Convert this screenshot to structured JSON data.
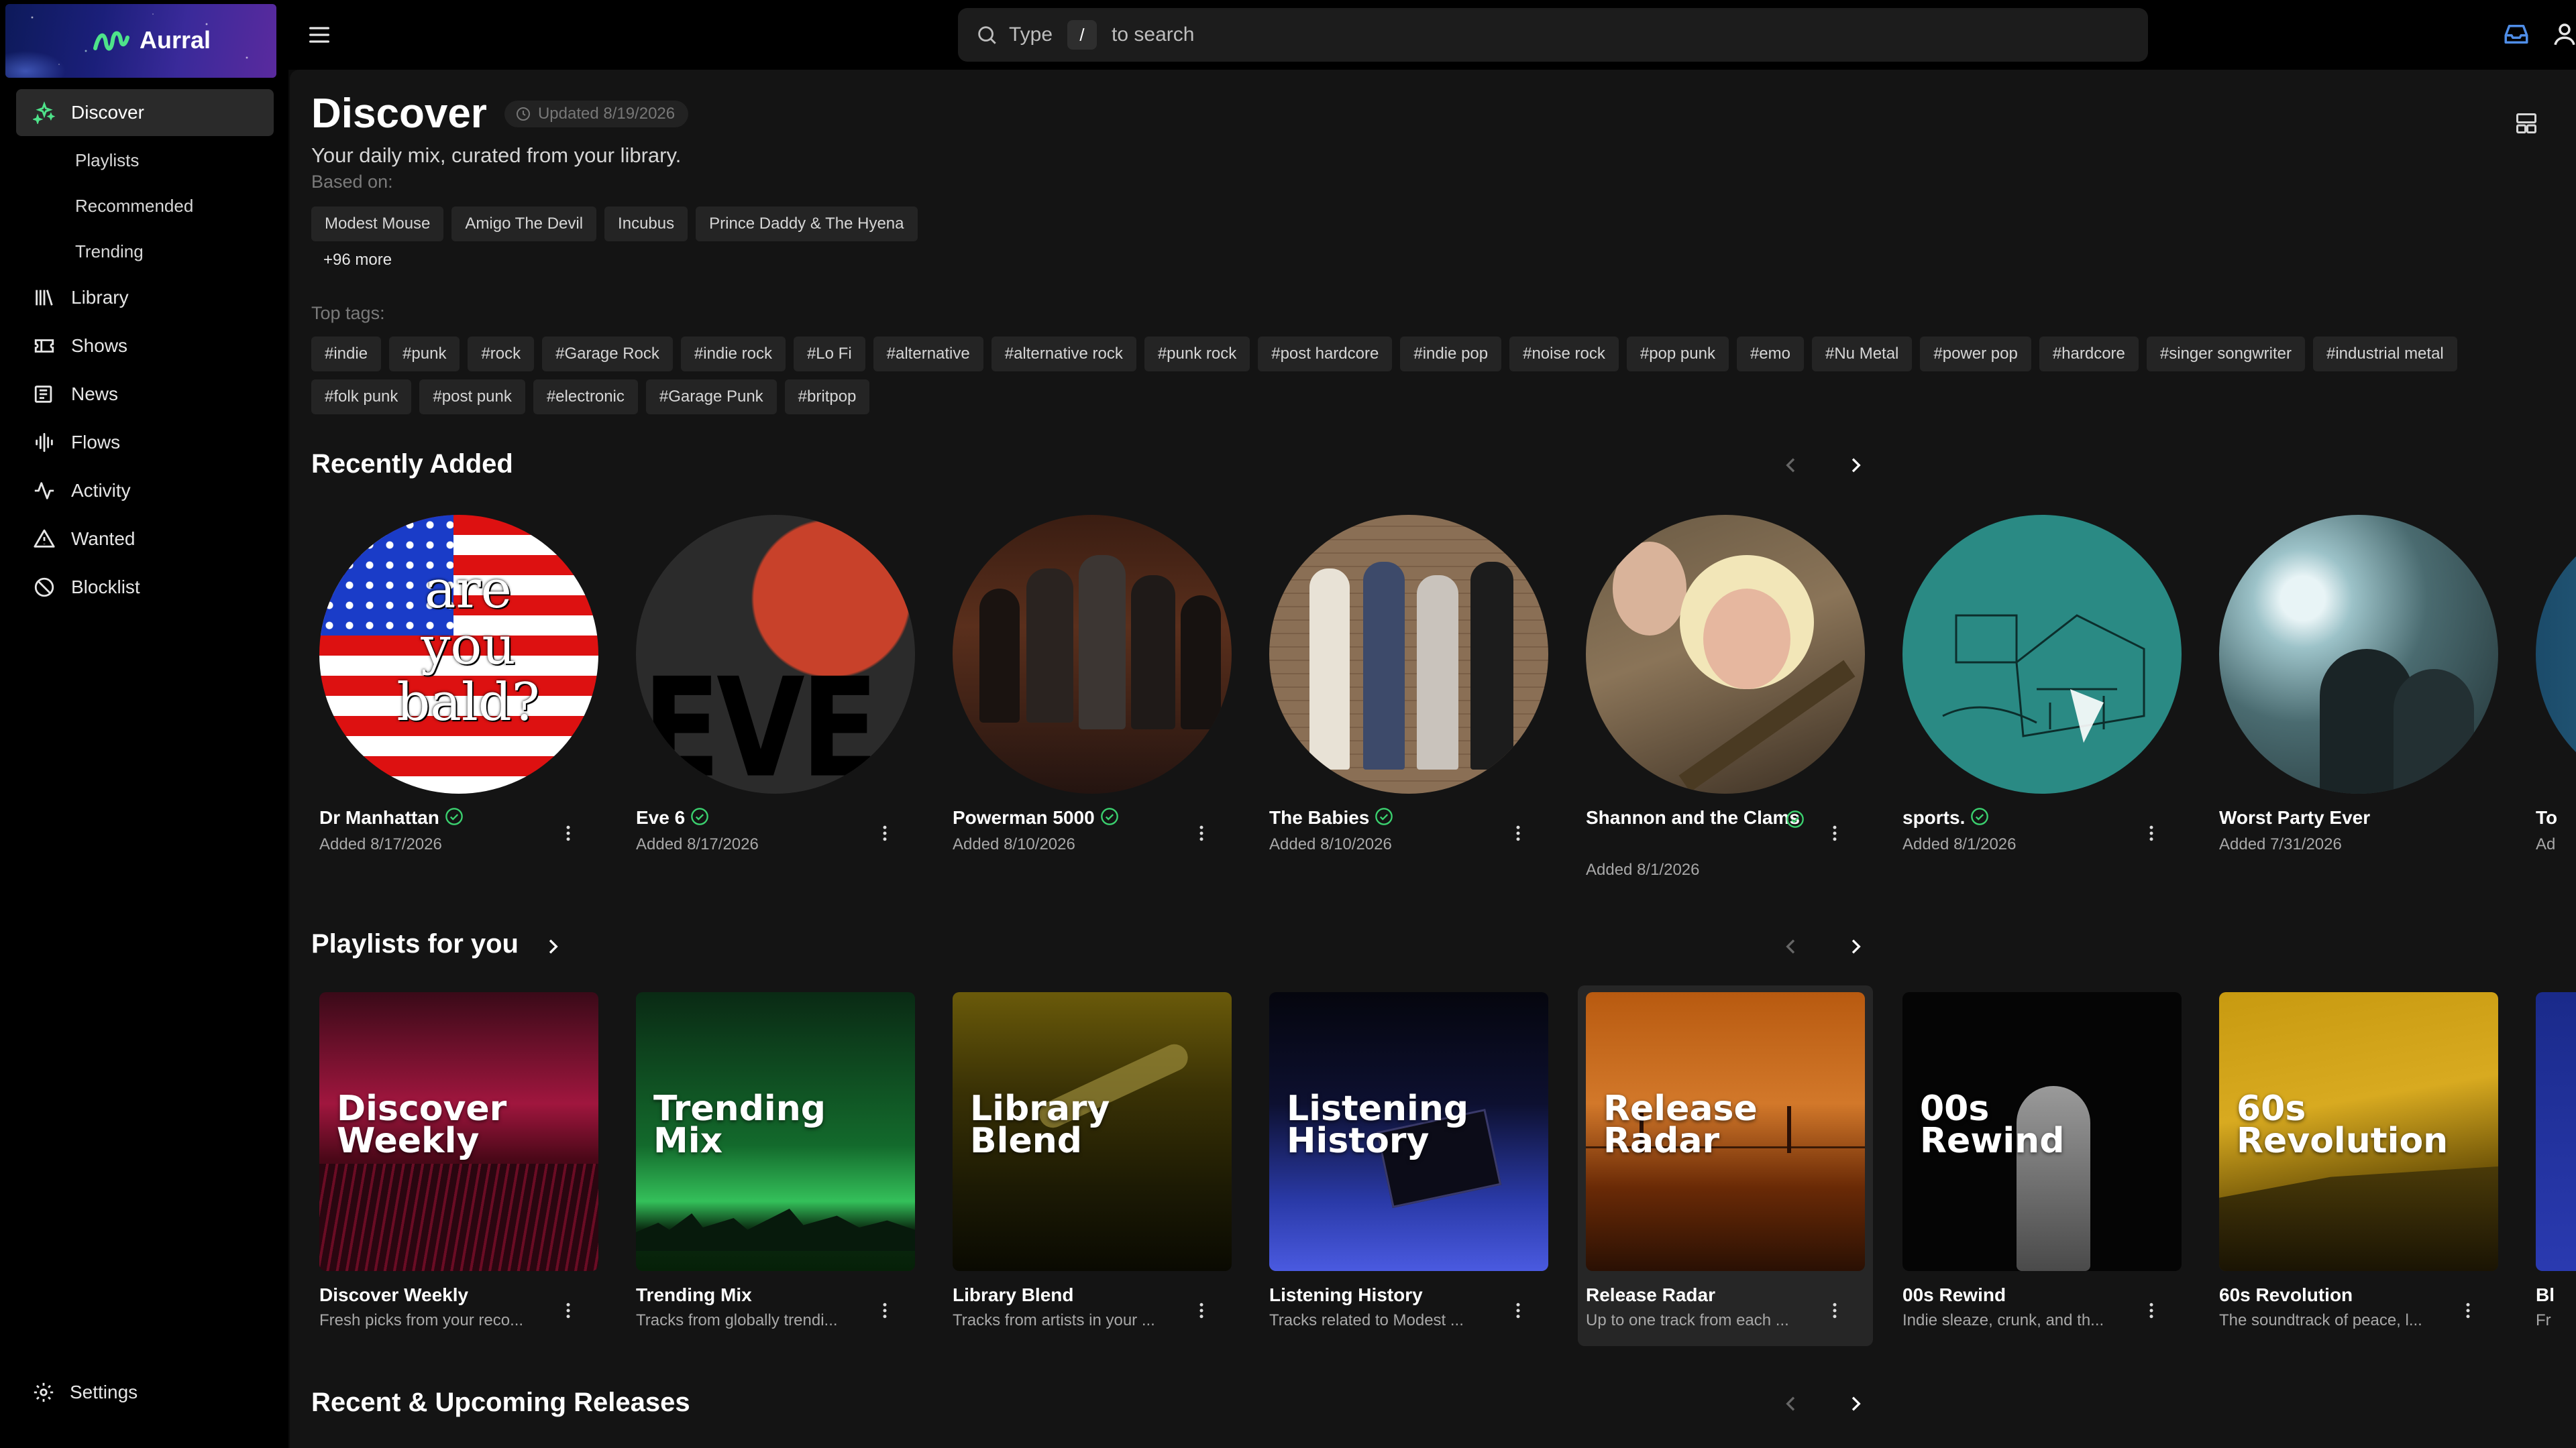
{
  "app": {
    "name": "Aurral"
  },
  "sidebar": {
    "items": [
      {
        "label": "Discover",
        "icon": "sparkles-icon",
        "active": true
      },
      {
        "label": "Playlists",
        "sub": true
      },
      {
        "label": "Recommended",
        "sub": true
      },
      {
        "label": "Trending",
        "sub": true
      },
      {
        "label": "Library",
        "icon": "library-icon"
      },
      {
        "label": "Shows",
        "icon": "ticket-icon"
      },
      {
        "label": "News",
        "icon": "newspaper-icon"
      },
      {
        "label": "Flows",
        "icon": "audio-wave-icon"
      },
      {
        "label": "Activity",
        "icon": "activity-icon"
      },
      {
        "label": "Wanted",
        "icon": "warning-triangle-icon"
      },
      {
        "label": "Blocklist",
        "icon": "ban-icon"
      }
    ],
    "settings_label": "Settings"
  },
  "search": {
    "prefix": "Type",
    "key": "/",
    "suffix": "to search"
  },
  "discover": {
    "title": "Discover",
    "updated": "Updated 8/19/2026",
    "subtitle": "Your daily mix, curated from your library.",
    "based_on_label": "Based on:",
    "based_on": [
      "Modest Mouse",
      "Amigo The Devil",
      "Incubus",
      "Prince Daddy & The Hyena"
    ],
    "more_label": "+96 more",
    "top_tags_label": "Top tags:",
    "tags": [
      "#indie",
      "#punk",
      "#rock",
      "#Garage Rock",
      "#indie rock",
      "#Lo Fi",
      "#alternative",
      "#alternative rock",
      "#punk rock",
      "#post hardcore",
      "#indie pop",
      "#noise rock",
      "#pop punk",
      "#emo",
      "#Nu Metal",
      "#power pop",
      "#hardcore",
      "#singer songwriter",
      "#industrial metal",
      "#folk punk",
      "#post punk",
      "#electronic",
      "#Garage Punk",
      "#britpop"
    ]
  },
  "recently_added": {
    "title": "Recently Added",
    "items": [
      {
        "name": "Dr Manhattan",
        "added": "Added 8/17/2026",
        "verified": true
      },
      {
        "name": "Eve 6",
        "added": "Added 8/17/2026",
        "verified": true
      },
      {
        "name": "Powerman 5000",
        "added": "Added 8/10/2026",
        "verified": true
      },
      {
        "name": "The Babies",
        "added": "Added 8/10/2026",
        "verified": true
      },
      {
        "name": "Shannon and the Clams",
        "added": "Added 8/1/2026",
        "verified": true
      },
      {
        "name": "sports.",
        "added": "Added 8/1/2026",
        "verified": true
      },
      {
        "name": "Worst Party Ever",
        "added": "Added 7/31/2026",
        "verified": false
      },
      {
        "name": "To",
        "added": "Ad",
        "verified": false
      }
    ],
    "cover_text": {
      "line1": "are",
      "line2": "you",
      "line3": "bald?",
      "eve": "EVE"
    }
  },
  "playlists": {
    "title": "Playlists for you",
    "items": [
      {
        "cover_line1": "Discover",
        "cover_line2": "Weekly",
        "name": "Discover Weekly",
        "desc": "Fresh picks from your reco..."
      },
      {
        "cover_line1": "Trending",
        "cover_line2": "Mix",
        "name": "Trending Mix",
        "desc": "Tracks from globally trendi..."
      },
      {
        "cover_line1": "Library",
        "cover_line2": "Blend",
        "name": "Library Blend",
        "desc": "Tracks from artists in your ..."
      },
      {
        "cover_line1": "Listening",
        "cover_line2": "History",
        "name": "Listening History",
        "desc": "Tracks related to Modest ..."
      },
      {
        "cover_line1": "Release",
        "cover_line2": "Radar",
        "name": "Release Radar",
        "desc": "Up to one track from each ..."
      },
      {
        "cover_line1": "00s",
        "cover_line2": "Rewind",
        "name": "00s Rewind",
        "desc": "Indie sleaze, crunk, and th..."
      },
      {
        "cover_line1": "60s",
        "cover_line2": "Revolution",
        "name": "60s Revolution",
        "desc": "The soundtrack of peace, l..."
      },
      {
        "name": "Bl",
        "desc": "Fr"
      }
    ]
  },
  "upcoming": {
    "title": "Recent & Upcoming Releases"
  }
}
